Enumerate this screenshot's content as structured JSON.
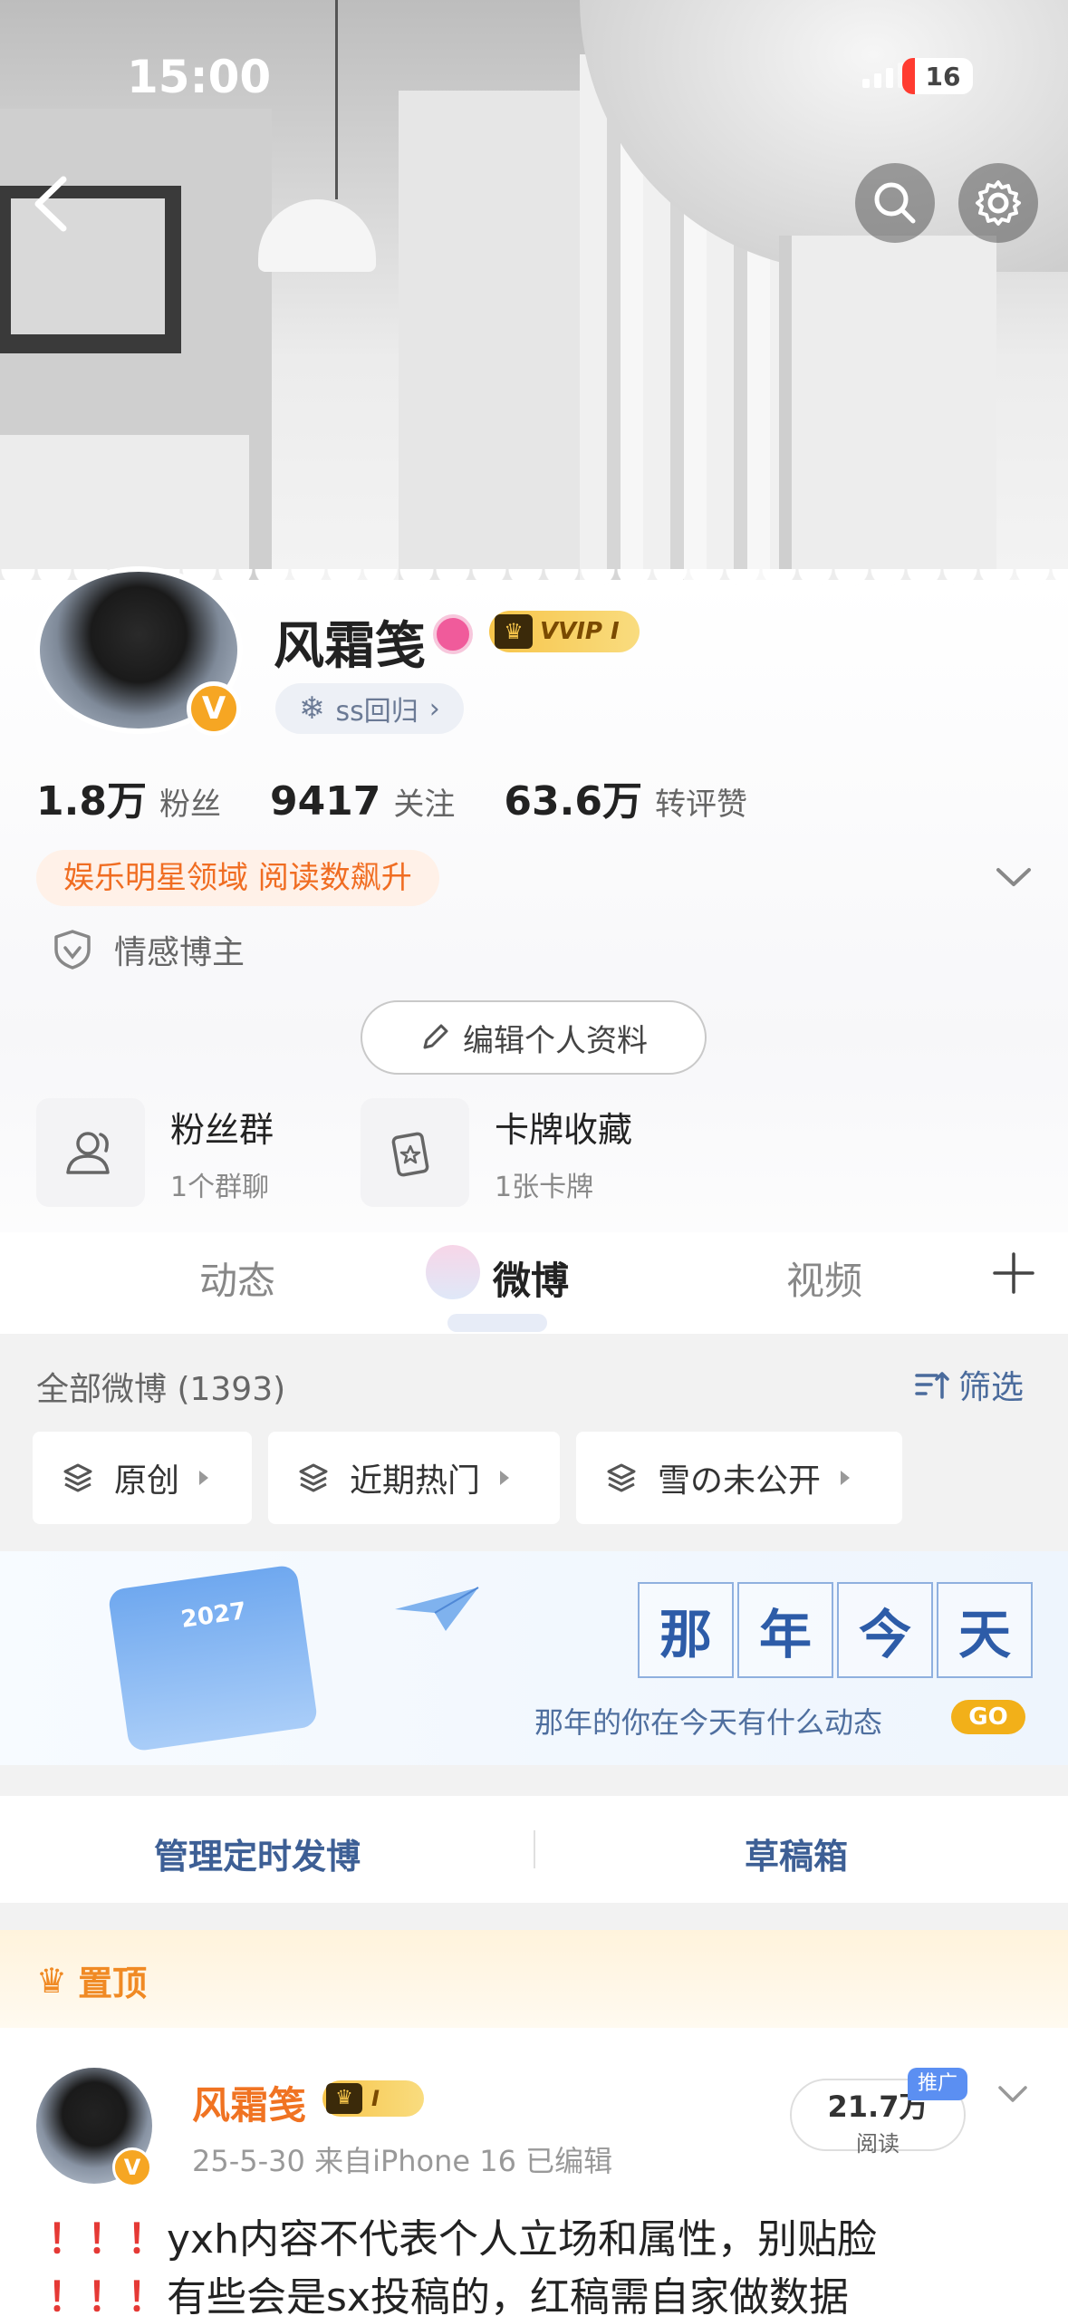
{
  "status_bar": {
    "time": "15:00",
    "battery": "16"
  },
  "profile": {
    "name": "风霜笺",
    "vip_label": "VVIP I",
    "tag_label": "ss回归",
    "stats": [
      {
        "value": "1.8万",
        "label": "粉丝"
      },
      {
        "value": "9417",
        "label": "关注"
      },
      {
        "value": "63.6万",
        "label": "转评赞"
      }
    ],
    "domain_tag": "娱乐明星领域 阅读数飙升",
    "blogger_label": "情感博主",
    "edit_label": "编辑个人资料",
    "fan_group": {
      "title": "粉丝群",
      "sub": "1个群聊"
    },
    "card_collection": {
      "title": "卡牌收藏",
      "sub": "1张卡牌"
    }
  },
  "tabs": [
    {
      "label": "动态"
    },
    {
      "label": "微博"
    },
    {
      "label": "视频"
    }
  ],
  "feed": {
    "all_label": "全部微博 (1393)",
    "filter_label": "筛选",
    "chips": [
      "原创",
      "近期热门",
      "雪の未公开"
    ],
    "banner": {
      "year": "2027",
      "chars": [
        "那",
        "年",
        "今",
        "天"
      ],
      "subtitle": "那年的你在今天有什么动态",
      "go": "GO"
    },
    "manage_label": "管理定时发博",
    "drafts_label": "草稿箱",
    "pinned_label": "置顶"
  },
  "post": {
    "author": "风霜笺",
    "vip_label": "I",
    "meta": "25-5-30  来自iPhone 16  已编辑",
    "reads_value": "21.7万",
    "reads_label": "阅读",
    "promo_label": "推广",
    "marks": "！！！",
    "line1": "yxh内容不代表个人立场和属性，别贴脸",
    "line2": "有些会是sx投稿的，红稿需自家做数据"
  }
}
